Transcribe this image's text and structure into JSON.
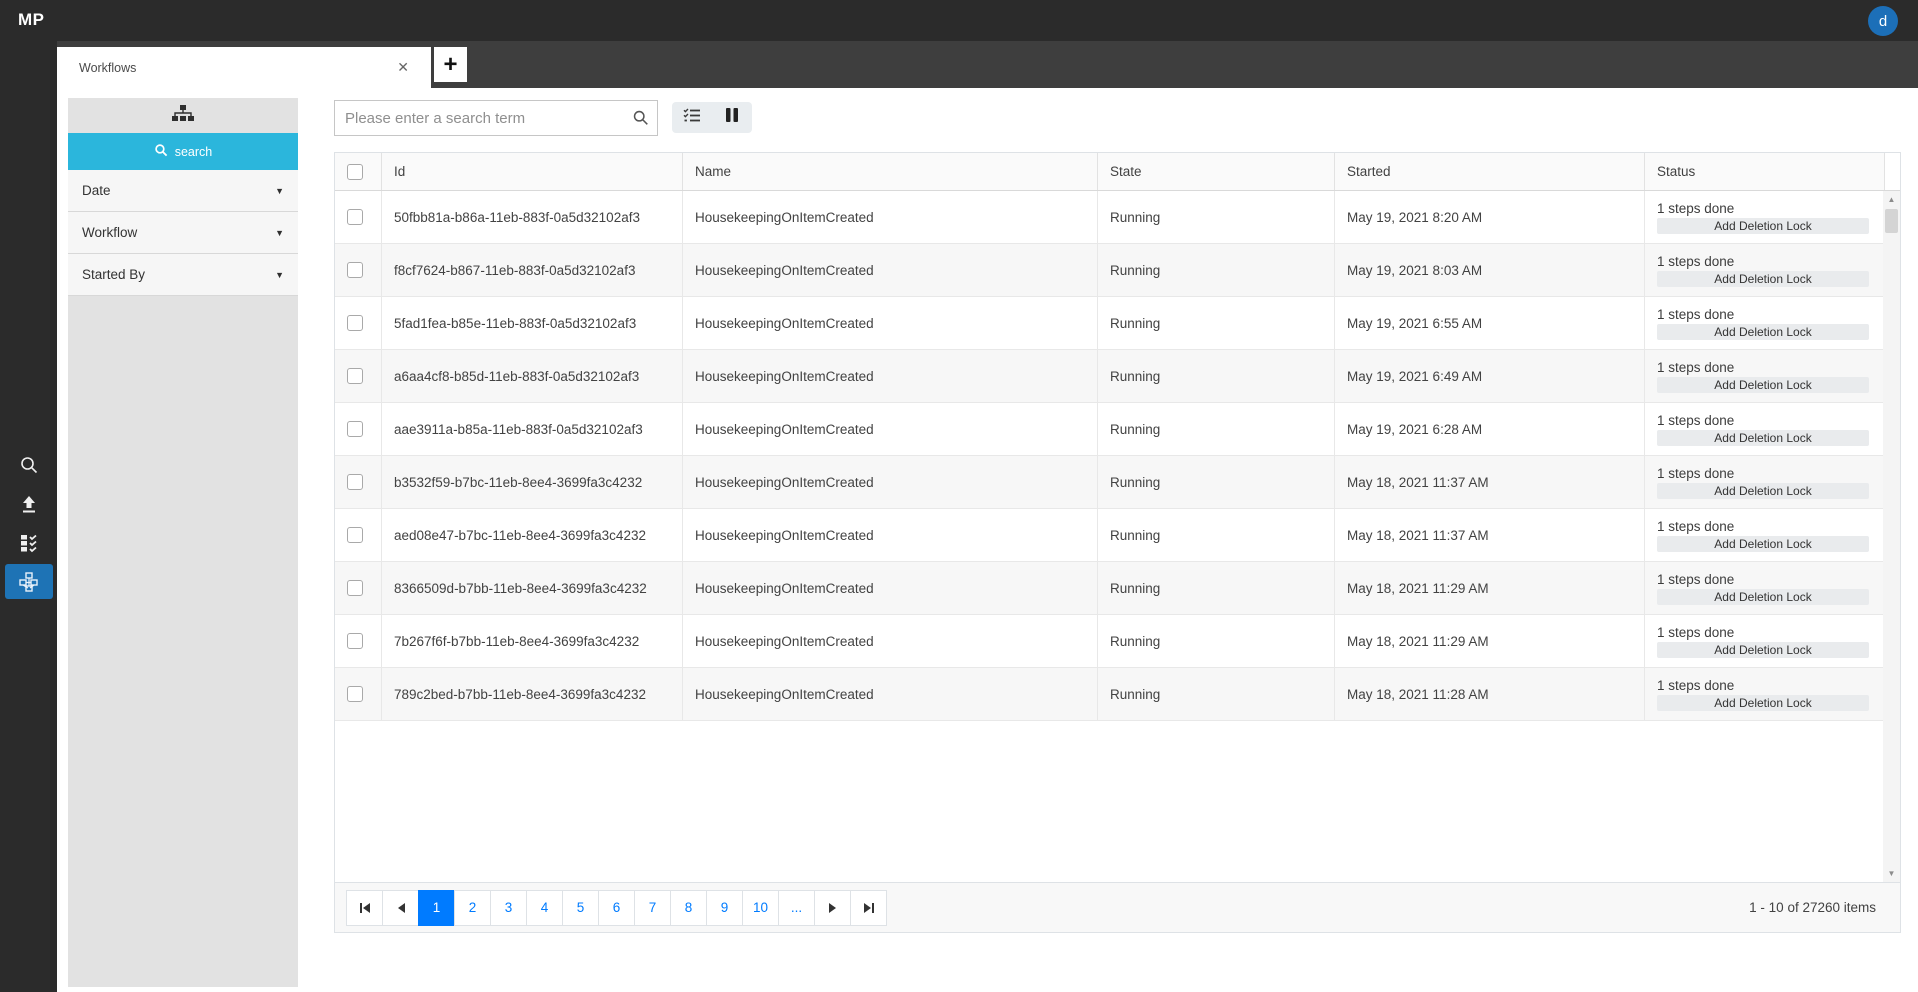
{
  "app": {
    "logo": "MP",
    "avatar_initial": "d"
  },
  "rail": {
    "items": [
      {
        "name": "search"
      },
      {
        "name": "upload"
      },
      {
        "name": "tasks"
      },
      {
        "name": "workflows",
        "active": true
      }
    ]
  },
  "tabs": {
    "items": [
      {
        "label": "Workflows",
        "close_icon": "✕"
      }
    ],
    "add_label": "+"
  },
  "filter_panel": {
    "search_button_label": "search",
    "sections": [
      {
        "label": "Date",
        "caret": "▼"
      },
      {
        "label": "Workflow",
        "caret": "▼"
      },
      {
        "label": "Started By",
        "caret": "▼"
      }
    ]
  },
  "toolbar": {
    "search_placeholder": "Please enter a search term"
  },
  "grid": {
    "columns": {
      "id": "Id",
      "name": "Name",
      "state": "State",
      "started": "Started",
      "status": "Status"
    },
    "rows": [
      {
        "id": "50fbb81a-b86a-11eb-883f-0a5d32102af3",
        "name": "HousekeepingOnItemCreated",
        "state": "Running",
        "started": "May 19, 2021 8:20 AM",
        "steps": "1 steps done",
        "action": "Add Deletion Lock"
      },
      {
        "id": "f8cf7624-b867-11eb-883f-0a5d32102af3",
        "name": "HousekeepingOnItemCreated",
        "state": "Running",
        "started": "May 19, 2021 8:03 AM",
        "steps": "1 steps done",
        "action": "Add Deletion Lock"
      },
      {
        "id": "5fad1fea-b85e-11eb-883f-0a5d32102af3",
        "name": "HousekeepingOnItemCreated",
        "state": "Running",
        "started": "May 19, 2021 6:55 AM",
        "steps": "1 steps done",
        "action": "Add Deletion Lock"
      },
      {
        "id": "a6aa4cf8-b85d-11eb-883f-0a5d32102af3",
        "name": "HousekeepingOnItemCreated",
        "state": "Running",
        "started": "May 19, 2021 6:49 AM",
        "steps": "1 steps done",
        "action": "Add Deletion Lock"
      },
      {
        "id": "aae3911a-b85a-11eb-883f-0a5d32102af3",
        "name": "HousekeepingOnItemCreated",
        "state": "Running",
        "started": "May 19, 2021 6:28 AM",
        "steps": "1 steps done",
        "action": "Add Deletion Lock"
      },
      {
        "id": "b3532f59-b7bc-11eb-8ee4-3699fa3c4232",
        "name": "HousekeepingOnItemCreated",
        "state": "Running",
        "started": "May 18, 2021 11:37 AM",
        "steps": "1 steps done",
        "action": "Add Deletion Lock"
      },
      {
        "id": "aed08e47-b7bc-11eb-8ee4-3699fa3c4232",
        "name": "HousekeepingOnItemCreated",
        "state": "Running",
        "started": "May 18, 2021 11:37 AM",
        "steps": "1 steps done",
        "action": "Add Deletion Lock"
      },
      {
        "id": "8366509d-b7bb-11eb-8ee4-3699fa3c4232",
        "name": "HousekeepingOnItemCreated",
        "state": "Running",
        "started": "May 18, 2021 11:29 AM",
        "steps": "1 steps done",
        "action": "Add Deletion Lock"
      },
      {
        "id": "7b267f6f-b7bb-11eb-8ee4-3699fa3c4232",
        "name": "HousekeepingOnItemCreated",
        "state": "Running",
        "started": "May 18, 2021 11:29 AM",
        "steps": "1 steps done",
        "action": "Add Deletion Lock"
      },
      {
        "id": "789c2bed-b7bb-11eb-8ee4-3699fa3c4232",
        "name": "HousekeepingOnItemCreated",
        "state": "Running",
        "started": "May 18, 2021 11:28 AM",
        "steps": "1 steps done",
        "action": "Add Deletion Lock"
      }
    ]
  },
  "pager": {
    "pages": [
      "1",
      "2",
      "3",
      "4",
      "5",
      "6",
      "7",
      "8",
      "9",
      "10"
    ],
    "current": "1",
    "ellipsis": "...",
    "info": "1 - 10 of 27260 items"
  },
  "colors": {
    "topbar": "#2b2b2b",
    "tabbar": "#3e3e3e",
    "accent_cyan": "#2bb6dc",
    "active_page_blue": "#007bff",
    "avatar_blue": "#1c6fb8",
    "rail_active_blue": "#1e73b5",
    "panel_gray": "#e2e2e2",
    "row_alt": "#f7f7f7"
  }
}
